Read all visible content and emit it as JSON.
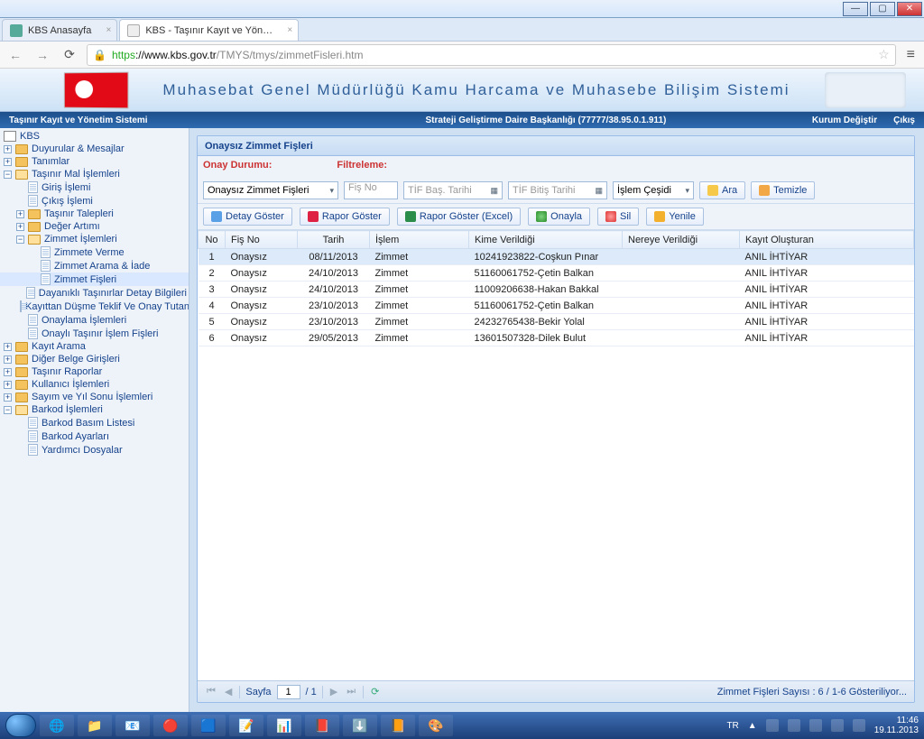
{
  "browser": {
    "tabs": [
      {
        "title": "KBS Anasayfa",
        "active": false
      },
      {
        "title": "KBS - Taşınır Kayıt ve Yön…",
        "active": true
      }
    ],
    "url_https": "https",
    "url_domain": "://www.kbs.gov.tr",
    "url_path": "/TMYS/tmys/zimmetFisleri.htm"
  },
  "banner": {
    "title": "Muhasebat Genel Müdürlüğü Kamu Harcama ve Muhasebe Bilişim Sistemi"
  },
  "subheader": {
    "left": "Taşınır Kayıt ve Yönetim Sistemi",
    "center": "Strateji Geliştirme Daire Başkanlığı (77777/38.95.0.1.911)",
    "link_change": "Kurum Değiştir",
    "link_exit": "Çıkış"
  },
  "tree": {
    "root": "KBS",
    "n_duyurular": "Duyurular & Mesajlar",
    "n_tanimlar": "Tanımlar",
    "n_tasinir_mal": "Taşınır Mal İşlemleri",
    "n_giris": "Giriş İşlemi",
    "n_cikis": "Çıkış İşlemi",
    "n_talep": "Taşınır Talepleri",
    "n_deger": "Değer Artımı",
    "n_zimmet_isl": "Zimmet İşlemleri",
    "n_zimmete_verme": "Zimmete Verme",
    "n_zimmet_arama": "Zimmet Arama & İade",
    "n_zimmet_fisleri": "Zimmet Fişleri",
    "n_dayanikli": "Dayanıklı Taşınırlar Detay Bilgileri",
    "n_kayittan": "Kayıttan Düşme Teklif Ve Onay Tutanağı",
    "n_onaylama": "Onaylama İşlemleri",
    "n_onayli_fis": "Onaylı Taşınır İşlem Fişleri",
    "n_kayit_arama": "Kayıt Arama",
    "n_diger_belge": "Diğer Belge Girişleri",
    "n_raporlar": "Taşınır Raporlar",
    "n_kullanici": "Kullanıcı İşlemleri",
    "n_sayim": "Sayım ve Yıl Sonu İşlemleri",
    "n_barkod": "Barkod İşlemleri",
    "n_barkod_basim": "Barkod Basım Listesi",
    "n_barkod_ayar": "Barkod Ayarları",
    "n_yardimci": "Yardımcı Dosyalar"
  },
  "panel": {
    "title": "Onaysız Zimmet Fişleri",
    "filter": {
      "onay_label": "Onay Durumu:",
      "onay_value": "Onaysız Zimmet Fişleri",
      "filt_label": "Filtreleme:",
      "ph_fisno": "Fiş No",
      "ph_tifbas": "TİF Baş. Tarihi",
      "ph_tifbit": "TİF Bitiş Tarihi",
      "ph_cesit": "İşlem Çeşidi",
      "btn_ara": "Ara",
      "btn_temizle": "Temizle"
    },
    "toolbar": {
      "detay": "Detay Göster",
      "rapor": "Rapor Göster",
      "rapor_excel": "Rapor Göster (Excel)",
      "onayla": "Onayla",
      "sil": "Sil",
      "yenile": "Yenile"
    },
    "cols": {
      "no": "No",
      "fisno": "Fiş No",
      "tarih": "Tarih",
      "islem": "İşlem",
      "kime": "Kime Verildiği",
      "nereye": "Nereye Verildiği",
      "kayit": "Kayıt Oluşturan"
    },
    "rows": [
      {
        "no": "1",
        "fisno": "Onaysız",
        "tarih": "08/11/2013",
        "islem": "Zimmet",
        "kime": "10241923822-Coşkun Pınar",
        "nereye": "",
        "kayit": "ANIL İHTİYAR"
      },
      {
        "no": "2",
        "fisno": "Onaysız",
        "tarih": "24/10/2013",
        "islem": "Zimmet",
        "kime": "51160061752-Çetin Balkan",
        "nereye": "",
        "kayit": "ANIL İHTİYAR"
      },
      {
        "no": "3",
        "fisno": "Onaysız",
        "tarih": "24/10/2013",
        "islem": "Zimmet",
        "kime": "11009206638-Hakan Bakkal",
        "nereye": "",
        "kayit": "ANIL İHTİYAR"
      },
      {
        "no": "4",
        "fisno": "Onaysız",
        "tarih": "23/10/2013",
        "islem": "Zimmet",
        "kime": "51160061752-Çetin Balkan",
        "nereye": "",
        "kayit": "ANIL İHTİYAR"
      },
      {
        "no": "5",
        "fisno": "Onaysız",
        "tarih": "23/10/2013",
        "islem": "Zimmet",
        "kime": "24232765438-Bekir Yolal",
        "nereye": "",
        "kayit": "ANIL İHTİYAR"
      },
      {
        "no": "6",
        "fisno": "Onaysız",
        "tarih": "29/05/2013",
        "islem": "Zimmet",
        "kime": "13601507328-Dilek Bulut",
        "nereye": "",
        "kayit": "ANIL İHTİYAR"
      }
    ],
    "pager": {
      "label_sayfa": "Sayfa",
      "page": "1",
      "total": "/ 1",
      "status": "Zimmet Fişleri Sayısı : 6 / 1-6 Gösteriliyor..."
    }
  },
  "taskbar": {
    "lang": "TR",
    "time": "11:46",
    "date": "19.11.2013"
  }
}
